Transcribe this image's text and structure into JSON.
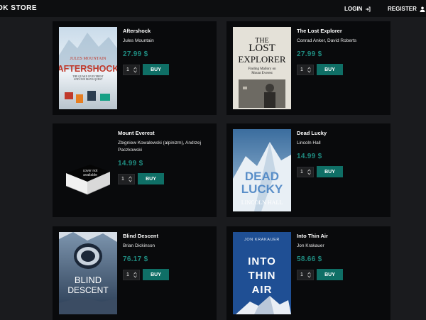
{
  "header": {
    "brand": "OK STORE",
    "login_label": "LOGIN",
    "register_label": "REGISTER",
    "login_icon": "login-icon",
    "register_icon": "user-icon"
  },
  "colors": {
    "accent": "#1f8a7f",
    "button": "#0f6f66",
    "background": "#1a1b1e",
    "card": "#090a0c"
  },
  "books": [
    {
      "title": "Aftershock",
      "author": "Jules Mountain",
      "price": "27.99 $",
      "quantity": "1",
      "buy_label": "BUY",
      "cover": {
        "line1": "JULES MOUNTAIN",
        "line2": "AFTERSHOCK",
        "line3": "THE QUAKE ON EVEREST",
        "line4": "AND ONE MAN'S QUEST"
      }
    },
    {
      "title": "The Lost Explorer",
      "author": "Conrad Anker, David Roberts",
      "price": "27.99 $",
      "quantity": "1",
      "buy_label": "BUY",
      "cover": {
        "line1": "THE",
        "line2": "LOST",
        "line3": "EXPLORER",
        "line4": "Finding Mallory on",
        "line5": "Mount Everest"
      }
    },
    {
      "title": "Mount Everest",
      "author": "Zbigniew Kowalewski (alpinizm), Andrzej Paczkowski",
      "price": "14.99 $",
      "quantity": "1",
      "buy_label": "BUY",
      "cover": {
        "line1": "cover not",
        "line2": "available"
      }
    },
    {
      "title": "Dead Lucky",
      "author": "Lincoln Hall",
      "price": "14.99 $",
      "quantity": "1",
      "buy_label": "BUY",
      "cover": {
        "line1": "DEAD",
        "line2": "LUCKY",
        "line3": "LINCOLN HALL"
      }
    },
    {
      "title": "Blind Descent",
      "author": "Brian Dickinson",
      "price": "76.17 $",
      "quantity": "1",
      "buy_label": "BUY",
      "cover": {
        "line1": "BLIND",
        "line2": "DESCENT"
      }
    },
    {
      "title": "Into Thin Air",
      "author": "Jon Krakauer",
      "price": "58.66 $",
      "quantity": "1",
      "buy_label": "BUY",
      "cover": {
        "line1": "JON KRAKAUER",
        "line2": "INTO",
        "line3": "THIN",
        "line4": "AIR"
      }
    }
  ]
}
